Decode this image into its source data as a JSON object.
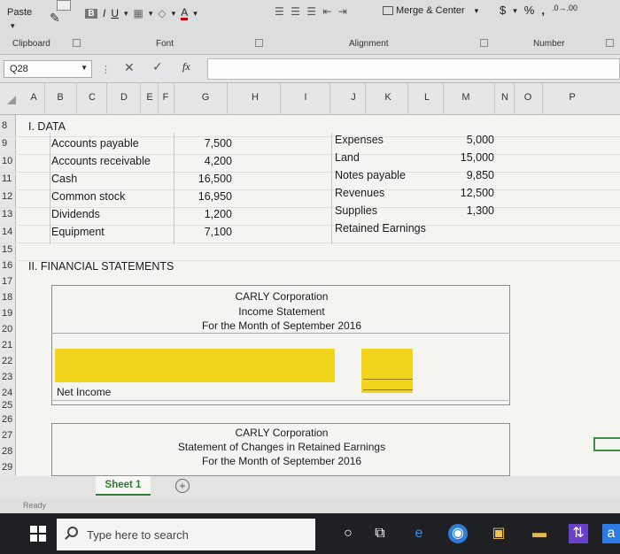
{
  "ribbon": {
    "paste_label": "Paste",
    "font_group": "Font",
    "clipboard_group": "Clipboard",
    "alignment_group": "Alignment",
    "number_group": "Number",
    "merge_label": "Merge & Center",
    "bold": "B",
    "italic": "I",
    "underline": "U",
    "currency": "$",
    "percent": "%",
    "comma": ","
  },
  "formula_bar": {
    "name_box": "Q28",
    "fx": "fx"
  },
  "columns": [
    "A",
    "B",
    "C",
    "D",
    "E",
    "F",
    "G",
    "H",
    "I",
    "J",
    "K",
    "L",
    "M",
    "N",
    "O",
    "P"
  ],
  "row_numbers": [
    "8",
    "9",
    "10",
    "11",
    "12",
    "13",
    "14",
    "15",
    "16",
    "17",
    "18",
    "19",
    "20",
    "21",
    "22",
    "23",
    "24",
    "25",
    "26",
    "27",
    "28",
    "29"
  ],
  "data_section": {
    "title": "I. DATA",
    "left": [
      {
        "label": "Accounts payable",
        "value": "7,500"
      },
      {
        "label": "Accounts receivable",
        "value": "4,200"
      },
      {
        "label": "Cash",
        "value": "16,500"
      },
      {
        "label": "Common stock",
        "value": "16,950"
      },
      {
        "label": "Dividends",
        "value": "1,200"
      },
      {
        "label": "Equipment",
        "value": "7,100"
      }
    ],
    "right": [
      {
        "label": "Expenses",
        "value": "5,000"
      },
      {
        "label": "Land",
        "value": "15,000"
      },
      {
        "label": "Notes payable",
        "value": "9,850"
      },
      {
        "label": "Revenues",
        "value": "12,500"
      },
      {
        "label": "Supplies",
        "value": "1,300"
      },
      {
        "label": "Retained Earnings",
        "value": ""
      }
    ]
  },
  "statements": {
    "title": "II. FINANCIAL STATEMENTS",
    "income": {
      "company": "CARLY Corporation",
      "name": "Income Statement",
      "period": "For the Month of September 2016",
      "net_income_label": "Net Income"
    },
    "retained": {
      "company": "CARLY Corporation",
      "name": "Statement of Changes in Retained Earnings",
      "period": "For the Month of September 2016"
    }
  },
  "sheet_tab": "Sheet 1",
  "status": "Ready",
  "taskbar": {
    "search_placeholder": "Type here to search"
  },
  "colors": {
    "highlight": "#f2d51c",
    "tab_accent": "#2e7d32"
  }
}
